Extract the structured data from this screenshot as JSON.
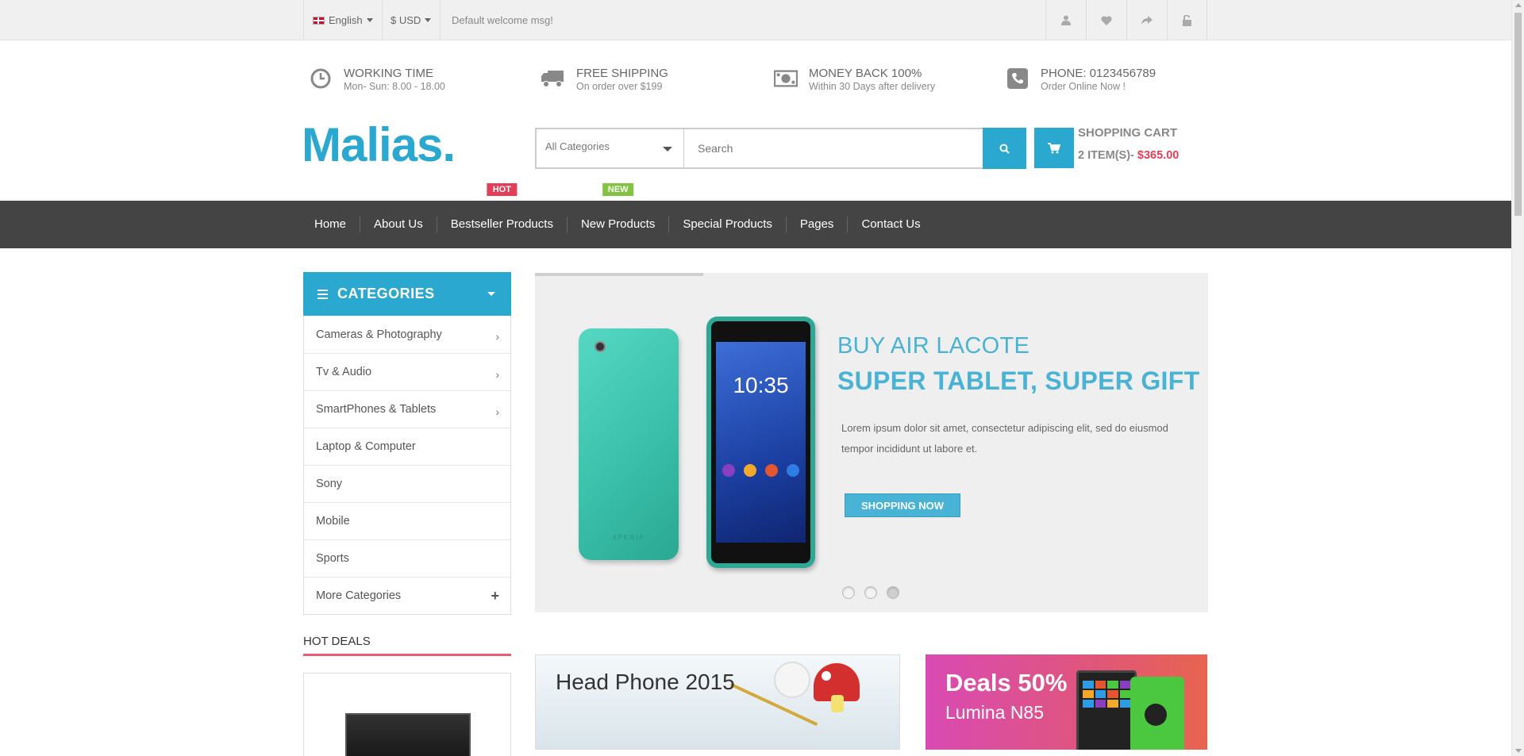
{
  "topbar": {
    "language": "English",
    "currency": "$ USD",
    "welcome": "Default welcome msg!",
    "icons": [
      "user-icon",
      "heart-icon",
      "share-icon",
      "unlock-icon"
    ]
  },
  "info": [
    {
      "icon": "clock-icon",
      "title": "WORKING TIME",
      "sub": "Mon- Sun: 8.00 - 18.00"
    },
    {
      "icon": "truck-icon",
      "title": "FREE SHIPPING",
      "sub": "On order over $199"
    },
    {
      "icon": "money-icon",
      "title": "MONEY BACK 100%",
      "sub": "Within 30 Days after delivery"
    },
    {
      "icon": "phone-icon",
      "title": "PHONE: 0123456789",
      "sub": "Order Online Now !"
    }
  ],
  "logo": "Malias.",
  "search": {
    "category": "All Categories",
    "placeholder": "Search"
  },
  "cart": {
    "title": "SHOPPING CART",
    "items": "2 ITEM(S)-",
    "total": "$365.00"
  },
  "nav": {
    "items": [
      {
        "label": "Home"
      },
      {
        "label": "About Us"
      },
      {
        "label": "Bestseller Products",
        "badge": "HOT"
      },
      {
        "label": "New Products",
        "badge": "NEW"
      },
      {
        "label": "Special Products"
      },
      {
        "label": "Pages"
      },
      {
        "label": "Contact Us"
      }
    ]
  },
  "categories": {
    "title": "CATEGORIES",
    "items": [
      {
        "label": "Cameras & Photography"
      },
      {
        "label": "Tv & Audio"
      },
      {
        "label": "SmartPhones & Tablets"
      },
      {
        "label": "Laptop & Computer"
      },
      {
        "label": "Sony"
      },
      {
        "label": "Mobile"
      },
      {
        "label": "Sports"
      },
      {
        "label": "More Categories"
      }
    ]
  },
  "slider": {
    "heading1": "BUY AIR LACOTE",
    "heading2": "SUPER TABLET, SUPER GIFT",
    "text": "Lorem ipsum dolor sit amet, consectetur adipiscing elit, sed do eiusmod tempor incididunt ut labore et.",
    "button": "SHOPPING NOW",
    "phone_brand": "XPERIA",
    "phone_time": "10:35",
    "active_slide": 3,
    "slide_count": 3
  },
  "hot_deals": {
    "title": "HOT DEALS"
  },
  "banners": {
    "banner1": "Head Phone 2015",
    "banner2_line1": "Deals 50%",
    "banner2_line2": "Lumina N85"
  },
  "colors": {
    "accent": "#2aa8cf",
    "nav_bg": "#444444",
    "hot": "#e23e57",
    "new": "#82c341",
    "price": "#e23e57"
  }
}
